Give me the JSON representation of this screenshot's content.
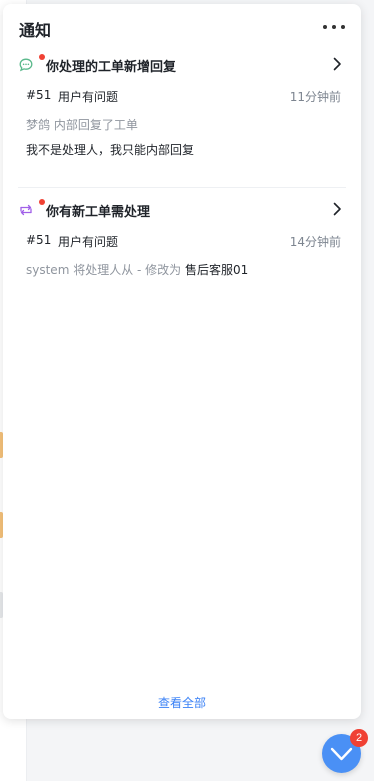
{
  "panel": {
    "title": "通知",
    "view_all": "查看全部"
  },
  "notifications": [
    {
      "type_icon": "chat-bubble-icon",
      "title": "你处理的工单新增回复",
      "ticket_no": "#51",
      "ticket_subject": "用户有问题",
      "time": "11分钟前",
      "meta": "梦鸽 内部回复了工单",
      "body": "我不是处理人，我只能内部回复"
    },
    {
      "type_icon": "transfer-icon",
      "title": "你有新工单需处理",
      "ticket_no": "#51",
      "ticket_subject": "用户有问题",
      "time": "14分钟前",
      "meta_prefix": "system 将处理人从 - 修改为",
      "meta_target": "售后客服01"
    }
  ],
  "fab": {
    "badge_count": "2"
  },
  "colors": {
    "accent": "#4a90f5",
    "badge": "#f04134",
    "link": "#3b82f6"
  }
}
